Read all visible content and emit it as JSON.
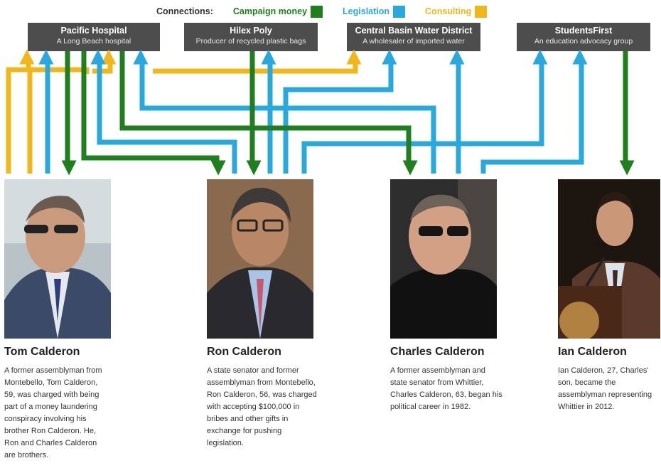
{
  "legend": {
    "title": "Connections:",
    "items": [
      {
        "label": "Campaign money",
        "color": "#1f7f1f"
      },
      {
        "label": "Legislation",
        "color": "#29a8dd"
      },
      {
        "label": "Consulting",
        "color": "#f0b71c"
      }
    ]
  },
  "organizations": [
    {
      "name": "Pacific Hospital",
      "description": "A Long Beach hospital"
    },
    {
      "name": "Hilex Poly",
      "description": "Producer of recycled plastic bags"
    },
    {
      "name": "Central Basin Water District",
      "description": "A wholesaler of imported water"
    },
    {
      "name": "StudentsFirst",
      "description": "An education advocacy group"
    }
  ],
  "people": [
    {
      "name": "Tom Calderon",
      "bio": "A former assemblyman from Montebello, Tom Calderon, 59, was charged with being part of a money laundering conspiracy involving his brother Ron Calderon. He, Ron and Charles Calderon are brothers."
    },
    {
      "name": "Ron Calderon",
      "bio": "A state senator and former assemblyman from Montebello, Ron Calderon, 56, was charged with accepting $100,000 in bribes and other gifts in exchange for pushing legislation."
    },
    {
      "name": "Charles Calderon",
      "bio": "A former assemblyman and state senator from Whittier, Charles Calderon, 63, began his political career in 1982."
    },
    {
      "name": "Ian Calderon",
      "bio": "Ian Calderon, 27, Charles' son, became the assemblyman representing Whittier in 2012."
    }
  ],
  "connections": [
    {
      "type": "consulting",
      "from": "Tom Calderon",
      "to": "Pacific Hospital"
    },
    {
      "type": "legislation",
      "from": "Tom Calderon",
      "to": "Pacific Hospital"
    },
    {
      "type": "campaign",
      "from": "Pacific Hospital",
      "to": "Tom Calderon"
    },
    {
      "type": "campaign",
      "from": "Pacific Hospital",
      "to": "Ron Calderon"
    },
    {
      "type": "consulting",
      "from": "Tom Calderon",
      "to": "Hilex Poly"
    },
    {
      "type": "legislation",
      "from": "Ron Calderon",
      "to": "Pacific Hospital"
    },
    {
      "type": "campaign",
      "from": "Pacific Hospital",
      "to": "Charles Calderon"
    },
    {
      "type": "legislation",
      "from": "Charles Calderon",
      "to": "Pacific Hospital"
    },
    {
      "type": "campaign",
      "from": "Hilex Poly",
      "to": "Ron Calderon"
    },
    {
      "type": "legislation",
      "from": "Ron Calderon",
      "to": "Hilex Poly"
    },
    {
      "type": "consulting",
      "from": "Tom Calderon",
      "to": "Central Basin Water District"
    },
    {
      "type": "legislation",
      "from": "Ron Calderon",
      "to": "Central Basin Water District"
    },
    {
      "type": "legislation",
      "from": "Charles Calderon",
      "to": "Central Basin Water District"
    },
    {
      "type": "legislation",
      "from": "Charles Calderon",
      "to": "StudentsFirst"
    },
    {
      "type": "legislation",
      "from": "Ian Calderon",
      "to": "StudentsFirst"
    },
    {
      "type": "campaign",
      "from": "StudentsFirst",
      "to": "Ian Calderon"
    }
  ]
}
